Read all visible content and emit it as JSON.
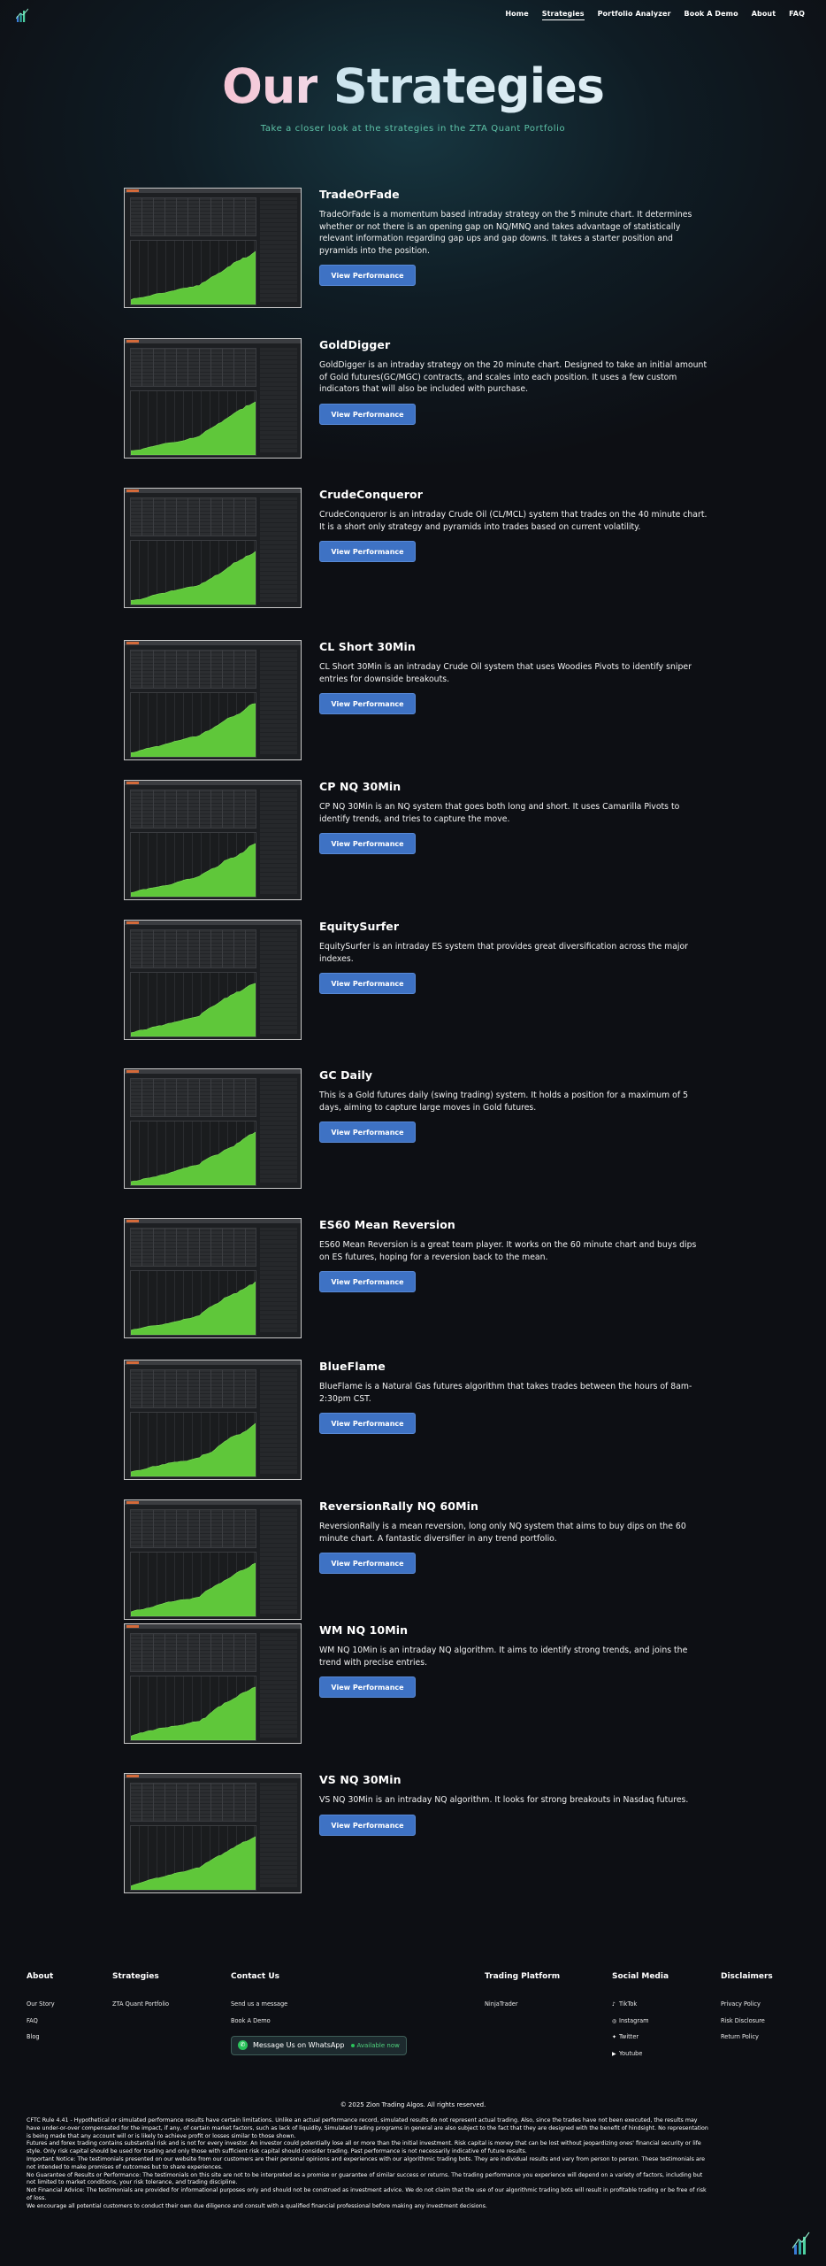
{
  "nav": {
    "links": [
      "Home",
      "Strategies",
      "Portfolio Analyzer",
      "Book A Demo",
      "About",
      "FAQ"
    ],
    "active": "Strategies"
  },
  "hero": {
    "title_part1": "Our",
    "title_part2": "Strategies",
    "subtitle": "Take a closer look at the strategies in the ZTA Quant Portfolio"
  },
  "strategies": [
    {
      "name": "TradeOrFade",
      "description": "TradeOrFade is a momentum based intraday strategy on the 5 minute chart. It determines whether or not there is an opening gap on NQ/MNQ and takes advantage of statistically relevant information regarding gap ups and gap downs. It takes a starter position and pyramids into the position.",
      "button": "View Performance"
    },
    {
      "name": "GoldDigger",
      "description": "GoldDigger is an intraday strategy on the 20 minute chart. Designed to take an initial amount of Gold futures(GC/MGC) contracts, and scales into each position. It uses a few custom indicators that will also be included with purchase.",
      "button": "View Performance"
    },
    {
      "name": "CrudeConqueror",
      "description": "CrudeConqueror is an intraday Crude Oil (CL/MCL) system that trades on the 40 minute chart. It is a short only strategy and pyramids into trades based on current volatility.",
      "button": "View Performance"
    },
    {
      "name": "CL Short 30Min",
      "description": "CL Short 30Min is an intraday Crude Oil system that uses Woodies Pivots to identify sniper entries for downside breakouts.",
      "button": "View Performance"
    },
    {
      "name": "CP NQ 30Min",
      "description": "CP NQ 30Min is an NQ system that goes both long and short. It uses Camarilla Pivots to identify trends, and tries to capture the move.",
      "button": "View Performance"
    },
    {
      "name": "EquitySurfer",
      "description": "EquitySurfer is an intraday ES system that provides great diversification across the major indexes.",
      "button": "View Performance"
    },
    {
      "name": "GC Daily",
      "description": "This is a Gold futures daily (swing trading) system. It holds a position for a maximum of 5 days, aiming to capture large moves in Gold futures.",
      "button": "View Performance"
    },
    {
      "name": "ES60 Mean Reversion",
      "description": "ES60 Mean Reversion is a great team player. It works on the 60 minute chart and buys dips on ES futures, hoping for a reversion back to the mean.",
      "button": "View Performance"
    },
    {
      "name": "BlueFlame",
      "description": "BlueFlame is a Natural Gas futures algorithm that takes trades between the hours of 8am-2:30pm CST.",
      "button": "View Performance"
    },
    {
      "name": "ReversionRally NQ 60Min",
      "description": "ReversionRally is a mean reversion, long only NQ system that aims to buy dips on the 60 minute chart. A fantastic diversifier in any trend portfolio.",
      "button": "View Performance"
    },
    {
      "name": "WM NQ 10Min",
      "description": "WM NQ 10Min is an intraday NQ algorithm. It aims to identify strong trends, and joins the trend with precise entries.",
      "button": "View Performance"
    },
    {
      "name": "VS NQ 30Min",
      "description": "VS NQ 30Min is an intraday NQ algorithm. It looks for strong breakouts in Nasdaq futures.",
      "button": "View Performance"
    }
  ],
  "footer": {
    "about": {
      "heading": "About",
      "links": [
        "Our Story",
        "FAQ",
        "Blog"
      ]
    },
    "strategies": {
      "heading": "Strategies",
      "links": [
        "ZTA Quant Portfolio"
      ]
    },
    "contact": {
      "heading": "Contact Us",
      "links": [
        "Send us a message",
        "Book A Demo"
      ],
      "whatsapp_label": "Message Us on WhatsApp",
      "whatsapp_status": "Available now"
    },
    "platform": {
      "heading": "Trading Platform",
      "links": [
        "NinjaTrader"
      ]
    },
    "social": {
      "heading": "Social Media",
      "links": [
        {
          "label": "TikTok",
          "icon": "tiktok-icon"
        },
        {
          "label": "Instagram",
          "icon": "instagram-icon"
        },
        {
          "label": "Twitter",
          "icon": "twitter-icon"
        },
        {
          "label": "Youtube",
          "icon": "youtube-icon"
        }
      ]
    },
    "disclaimers": {
      "heading": "Disclaimers",
      "links": [
        "Privacy Policy",
        "Risk Disclosure",
        "Return Policy"
      ]
    },
    "copyright": "© 2025 Zion Trading Algos. All rights reserved.",
    "disclaimer_paragraphs": [
      "CFTC Rule 4.41 - Hypothetical or simulated performance results have certain limitations. Unlike an actual performance record, simulated results do not represent actual trading. Also, since the trades have not been executed, the results may have under-or-over compensated for the impact, if any, of certain market factors, such as lack of liquidity. Simulated trading programs in general are also subject to the fact that they are designed with the benefit of hindsight. No representation is being made that any account will or is likely to achieve profit or losses similar to those shown.",
      "Futures and forex trading contains substantial risk and is not for every investor. An investor could potentially lose all or more than the initial investment. Risk capital is money that can be lost without jeopardizing ones' financial security or life style. Only risk capital should be used for trading and only those with sufficient risk capital should consider trading. Past performance is not necessarily indicative of future results.",
      "Important Notice: The testimonials presented on our website from our customers are their personal opinions and experiences with our algorithmic trading bots. They are individual results and vary from person to person. These testimonials are not intended to make promises of outcomes but to share experiences.",
      "No Guarantee of Results or Performance: The testimonials on this site are not to be interpreted as a promise or guarantee of similar success or returns. The trading performance you experience will depend on a variety of factors, including but not limited to market conditions, your risk tolerance, and trading discipline.",
      "Not Financial Advice: The testimonials are provided for informational purposes only and should not be construed as investment advice. We do not claim that the use of our algorithmic trading bots will result in profitable trading or be free of risk of loss.",
      "We encourage all potential customers to conduct their own due diligence and consult with a qualified financial professional before making any investment decisions."
    ]
  },
  "colors": {
    "background": "#0d0f14",
    "accent_teal": "#5ec4a8",
    "button_blue": "#3e72c4",
    "chart_green": "#5fc73a",
    "whatsapp_green": "#29c35a"
  }
}
